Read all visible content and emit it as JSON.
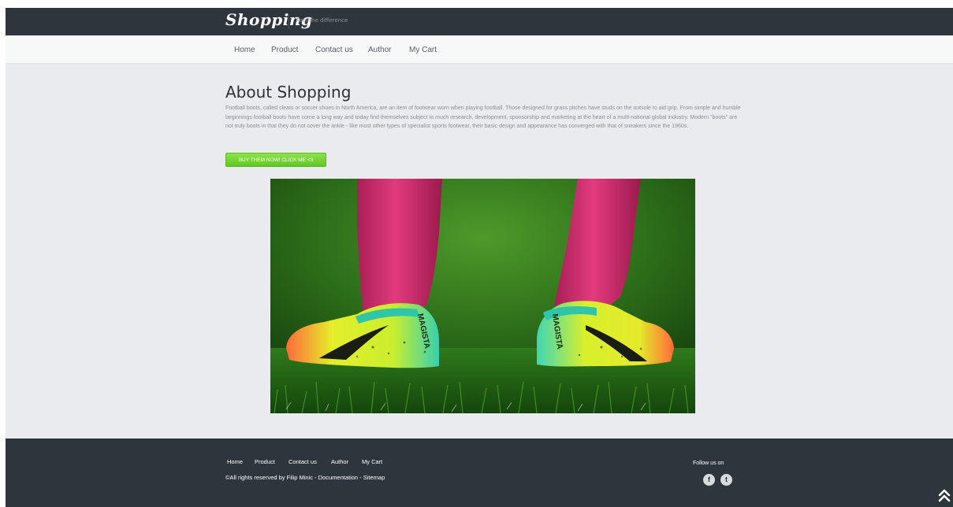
{
  "header": {
    "logo": "Shopping",
    "tagline": "Feel the difference"
  },
  "nav": {
    "items": [
      "Home",
      "Product",
      "Contact us",
      "Author",
      "My Cart"
    ]
  },
  "main": {
    "title": "About Shopping",
    "description": "Football boots, called cleats or soccer shoes in North America, are an item of footwear worn when playing football. Those designed for grass pitches have studs on the outsole to aid grip. From simple and humble beginnings football boots have come a long way and today find themselves subject to much research, development, sponsorship and marketing at the heart of a multi-national global industry. Modern \"boots\" are not truly boots in that they do not cover the ankle - like most other types of specialist sports footwear, their basic design and appearance has converged with that of sneakers since the 1960s.",
    "cta_label": "BUY THEM NOW! CLICK ME <3",
    "hero_boot_text": [
      "MAGISTA",
      "MAGISTA"
    ]
  },
  "footer": {
    "links": [
      "Home",
      "Product",
      "Contact us",
      "Author",
      "My Cart"
    ],
    "copyright": "©All rights reserved by Filip Minic - Documentation - Sitemap",
    "follow_label": "Follow us on",
    "social": [
      {
        "name": "facebook-icon",
        "glyph": "f"
      },
      {
        "name": "twitter-icon",
        "glyph": "t"
      }
    ]
  },
  "colors": {
    "header_bg": "#2e353d",
    "page_bg": "#e9ebee",
    "accent_green": "#62c823",
    "sock_pink": "#d6306f"
  },
  "icons": {
    "scroll_top": "double-chevron-up-icon"
  }
}
